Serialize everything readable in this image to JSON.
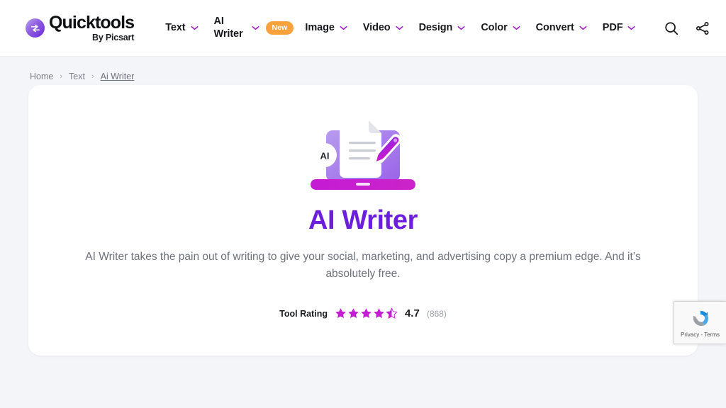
{
  "header": {
    "logo": {
      "main": "Quicktools",
      "sub": "By Picsart",
      "icon": "quicktools-logo-icon"
    },
    "nav": [
      {
        "label": "Text",
        "has_caret": true,
        "badge": null
      },
      {
        "label": "AI Writer",
        "has_caret": true,
        "badge": "New"
      },
      {
        "label": "Image",
        "has_caret": true,
        "badge": null
      },
      {
        "label": "Video",
        "has_caret": true,
        "badge": null
      },
      {
        "label": "Design",
        "has_caret": true,
        "badge": null
      },
      {
        "label": "Color",
        "has_caret": true,
        "badge": null
      },
      {
        "label": "Convert",
        "has_caret": true,
        "badge": null
      },
      {
        "label": "PDF",
        "has_caret": true,
        "badge": null
      }
    ],
    "actions": [
      {
        "icon": "search-icon"
      },
      {
        "icon": "share-icon"
      }
    ]
  },
  "breadcrumb": {
    "items": [
      {
        "label": "Home",
        "current": false
      },
      {
        "label": "Text",
        "current": false
      },
      {
        "label": "Ai Writer",
        "current": true
      }
    ],
    "separator": "›"
  },
  "hero": {
    "illustration": "ai-writer-illustration",
    "illustration_badge": "AI",
    "title": "AI Writer",
    "description": "AI Writer takes the pain out of writing to give your social, marketing, and advertising copy a premium edge. And it’s absolutely free."
  },
  "rating": {
    "label": "Tool Rating",
    "score": "4.7",
    "count": "(868)",
    "stars_filled": 4,
    "stars_half": 1,
    "stars_total": 5
  },
  "recaptcha": {
    "text": "Privacy - Terms",
    "icon": "recaptcha-icon"
  },
  "colors": {
    "brand_purple": "#6b1fdd",
    "accent_magenta": "#c41bd4",
    "badge_orange": "#f9a23b",
    "page_bg": "#f4f5f8",
    "card_bg": "#ffffff",
    "text_muted": "#6c717c"
  }
}
